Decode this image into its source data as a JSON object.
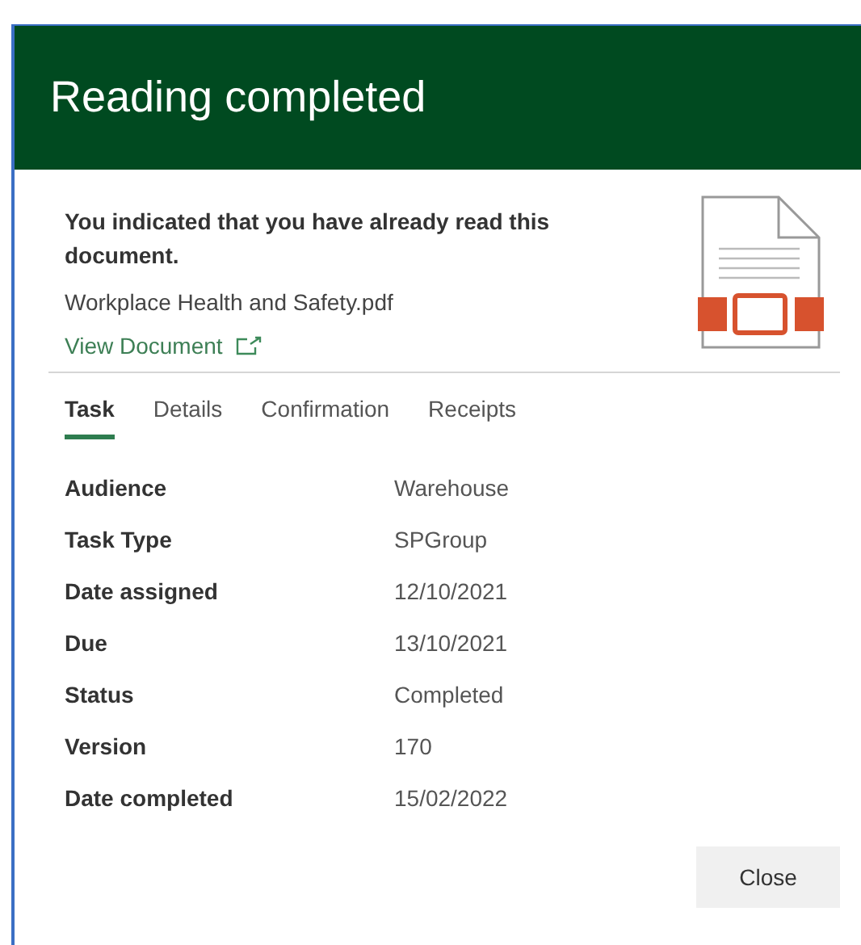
{
  "dialog": {
    "title": "Reading completed"
  },
  "message": "You indicated that you have already read this document.",
  "file_name": "Workplace Health and Safety.pdf",
  "view_link": "View Document",
  "tabs": [
    {
      "label": "Task",
      "selected": true
    },
    {
      "label": "Details",
      "selected": false
    },
    {
      "label": "Confirmation",
      "selected": false
    },
    {
      "label": "Receipts",
      "selected": false
    }
  ],
  "fields": [
    {
      "label": "Audience",
      "value": "Warehouse"
    },
    {
      "label": "Task Type",
      "value": "SPGroup"
    },
    {
      "label": "Date assigned",
      "value": "12/10/2021"
    },
    {
      "label": "Due",
      "value": "13/10/2021"
    },
    {
      "label": "Status",
      "value": "Completed"
    },
    {
      "label": "Version",
      "value": "170"
    },
    {
      "label": "Date completed",
      "value": "15/02/2022"
    }
  ],
  "buttons": [
    "Close"
  ]
}
